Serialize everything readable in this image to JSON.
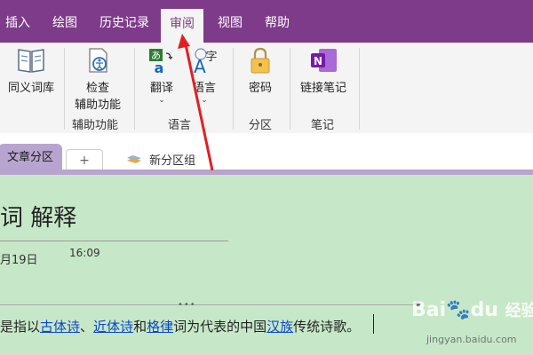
{
  "menu": [
    "插入",
    "绘图",
    "历史记录",
    "审阅",
    "视图",
    "帮助"
  ],
  "ribbon": {
    "thesaurus": "同义词库",
    "check": [
      "检查",
      "辅助功能"
    ],
    "translate": "翻译",
    "language": "语言",
    "password": "密码",
    "link": "链接笔记",
    "groups": {
      "a11y": "辅助功能",
      "lang": "语言",
      "section": "分区",
      "notes": "笔记"
    }
  },
  "tabs": {
    "section": "文章分区",
    "add": "+",
    "group": "新分区组"
  },
  "page": {
    "title": "词 解释",
    "date": "月19日",
    "time": "16:09",
    "body": {
      "p1": "是指以",
      "l1": "古体诗",
      "p2": "、",
      "l2": "近体诗",
      "p3": "和",
      "l3": "格律",
      "p4": "词为代表的中国",
      "l4": "汉族",
      "p5": "传统诗歌。"
    }
  },
  "watermark": {
    "brand": "Bai",
    "brand2": "du",
    "cn": "经验",
    "url": "jingyan.baidu.com"
  },
  "colors": {
    "accent": "#7d3b8a",
    "page": "#c7e8c8",
    "tab": "#b8a5cf",
    "arrow": "#e02020"
  }
}
